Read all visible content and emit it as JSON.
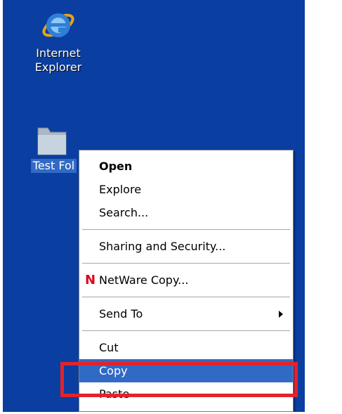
{
  "desktop": {
    "icons": [
      {
        "name": "ie",
        "label_line1": "Internet",
        "label_line2": "Explorer"
      },
      {
        "name": "folder",
        "label": "Test Fol"
      }
    ]
  },
  "context_menu": {
    "items": [
      {
        "label": "Open"
      },
      {
        "label": "Explore"
      },
      {
        "label": "Search..."
      },
      {
        "label": "Sharing and Security..."
      },
      {
        "label": "NetWare Copy...",
        "icon_text": "N"
      },
      {
        "label": "Send To"
      },
      {
        "label": "Cut"
      },
      {
        "label": "Copy"
      },
      {
        "label": "Paste"
      }
    ],
    "selected_item": "Copy"
  },
  "colors": {
    "desktop": "#0a3ea1",
    "selection": "#316ac5",
    "highlight_box": "#e4222a",
    "netware_icon": "#e0001b"
  },
  "icons": {
    "ie": "internet-explorer-icon",
    "folder": "folder-icon",
    "netware": "netware-icon",
    "submenu": "submenu-arrow-icon"
  }
}
